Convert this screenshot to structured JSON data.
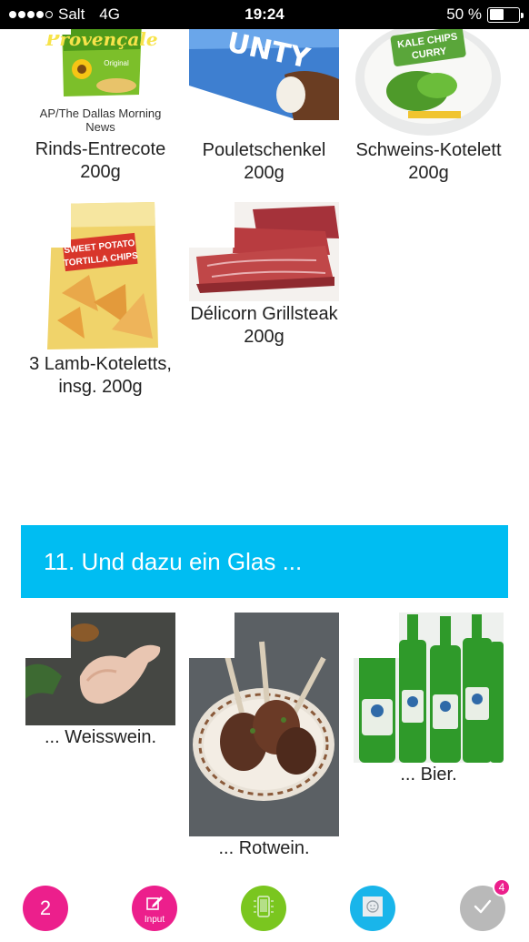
{
  "status_bar": {
    "carrier": "Salt",
    "network": "4G",
    "time": "19:24",
    "battery": "50 %",
    "battery_level": 0.5
  },
  "top_row": [
    {
      "caption": "AP/The Dallas Morning News",
      "label": "Rinds-Entrecote 200g",
      "image": "provencale-chips-bag"
    },
    {
      "caption": "",
      "label": "Pouletschenkel 200g",
      "image": "bounty-bar"
    },
    {
      "caption": "",
      "label": "Schweins-Kotelett 200g",
      "image": "kale-chips-curry"
    }
  ],
  "second_row": [
    {
      "label": "3 Lamb-Koteletts, insg. 200g",
      "image": "sweet-potato-chips-bag"
    },
    {
      "label": "Délicorn Grillsteak 200g",
      "image": "raw-beef-steak"
    }
  ],
  "section": {
    "title": "11. Und dazu ein Glas ..."
  },
  "drink_options": [
    {
      "label": "... Weisswein.",
      "image": "raw-chicken-leg"
    },
    {
      "label": "... Rotwein.",
      "image": "lamb-chops-plate"
    },
    {
      "label": "... Bier.",
      "image": "green-beer-bottles"
    }
  ],
  "bottom_bar": {
    "page_number": "2",
    "input_label": "Input",
    "badge_count": "4",
    "colors": {
      "page": "#ec1f8c",
      "input": "#ec1f8c",
      "device": "#7ac61f",
      "feedback": "#19b5ea",
      "done": "#b9b9b9"
    }
  }
}
